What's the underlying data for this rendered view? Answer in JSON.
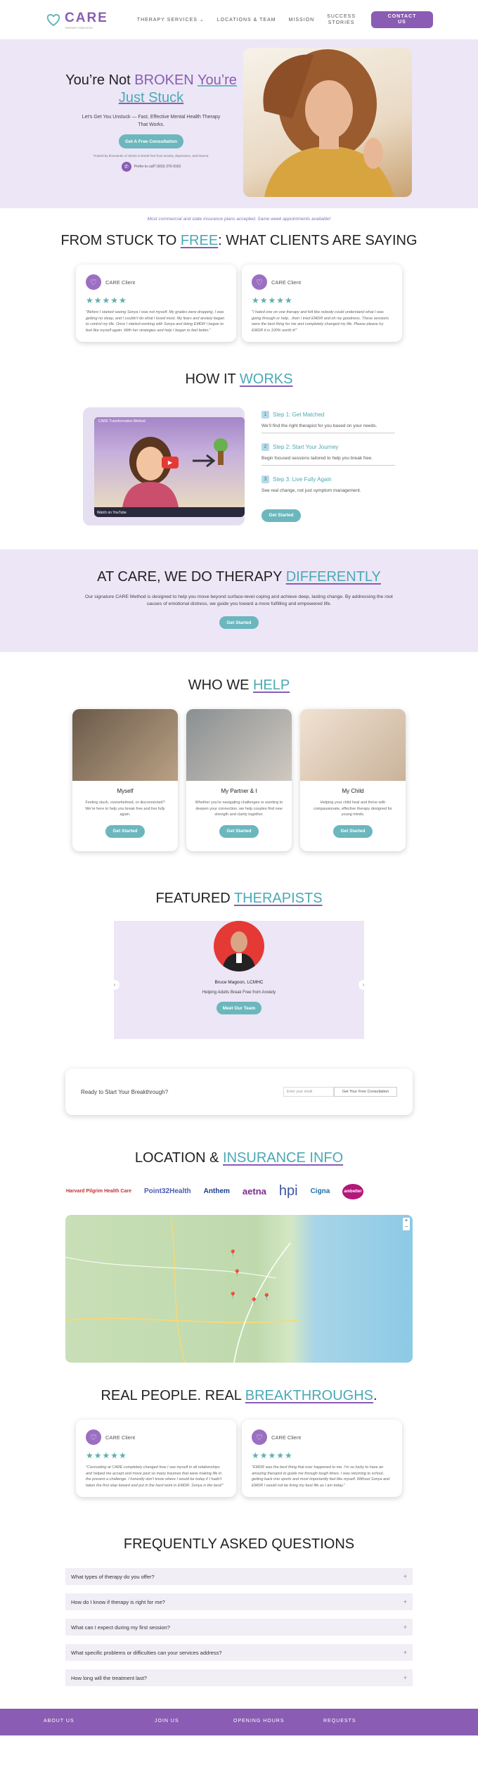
{
  "brand": {
    "name": "CARE",
    "tagline": "THERAPY SERVICES",
    "purple": "#8a5cb3",
    "teal": "#4aa9b5",
    "lavender": "#ece6f6"
  },
  "nav": {
    "items": [
      "THERAPY SERVICES",
      "LOCATIONS & TEAM",
      "MISSION"
    ],
    "success_1": "SUCCESS",
    "success_2": "STORIES",
    "contact_1": "CONTACT",
    "contact_2": "US"
  },
  "hero": {
    "title_1": "You’re Not",
    "title_broken": "BROKEN",
    "title_youre": "You’re",
    "title_stuck": "Just Stuck",
    "subtitle": "Let’s Get You Unstuck — Fast, Effective Mental Health Therapy That Works.",
    "cta": "Get A Free Consultation",
    "trust": "Trusted by thousands of clients to break free from anxiety, depression, and trauma.",
    "call": "Prefer to call? (603) 370-9163"
  },
  "insurance_note": "Most commercial and state insurance plans accepted. Same week appointments available!",
  "testimonials": {
    "title_a": "FROM STUCK TO ",
    "title_hl": "FREE",
    "title_b": ": WHAT CLIENTS ARE SAYING",
    "items": [
      {
        "name": "CARE Client",
        "stars": "★★★★★",
        "text": "\"Before I started seeing Sonya I was not myself. My grades were dropping, I was getting no sleep, and I couldn’t do what I loved most. My fears and anxiety began to control my life. Once I started working with Sonya and doing EMDR I began to feel like myself again. With her strategies and help I began to feel better.\""
      },
      {
        "name": "CARE Client",
        "stars": "★★★★★",
        "text": "\"I hated one on one therapy and felt like nobody could understand what I was going through or help…then I tried EMDR and oh my goodness. These sessions were the best thing for me and completely changed my life. Please please try EMDR it is 100% worth it!\""
      }
    ]
  },
  "how": {
    "title_a": "HOW IT ",
    "title_hl": "WORKS",
    "video_title": "CARE Transformation Method",
    "video_watch": "Watch on YouTube",
    "steps": [
      {
        "n": "1",
        "title": "Step 1: Get Matched",
        "desc": "We’ll find the right therapist for you based on your needs."
      },
      {
        "n": "2",
        "title": "Step 2: Start Your Journey",
        "desc": "Begin focused sessions tailored to help you break free."
      },
      {
        "n": "3",
        "title": "Step 3: Live Fully Again",
        "desc": "See real change, not just symptom management."
      }
    ],
    "cta": "Get Started"
  },
  "diff": {
    "title_a": "AT CARE, WE DO THERAPY ",
    "title_hl": "DIFFERENTLY",
    "text": "Our signature CARE Method is designed to help you move beyond surface-level coping and achieve deep, lasting change. By addressing the root causes of emotional distress, we guide you toward a more fulfilling and empowered life.",
    "cta": "Get Started"
  },
  "who": {
    "title_a": "WHO WE ",
    "title_hl": "HELP",
    "cards": [
      {
        "title": "Myself",
        "text": "Feeling stuck, overwhelmed, or disconnected? We’re here to help you break free and live fully again.",
        "cta": "Get Started"
      },
      {
        "title": "My Partner & I",
        "text": "Whether you’re navigating challenges or wanting to deepen your connection, we help couples find new strength and clarity together.",
        "cta": "Get Started"
      },
      {
        "title": "My Child",
        "text": "Helping your child heal and thrive with compassionate, effective therapy designed for young minds.",
        "cta": "Get Started"
      }
    ]
  },
  "featured": {
    "title_a": "FEATURED ",
    "title_hl": "THERAPISTS",
    "name": "Bruce Magoon, LCMHC",
    "sub": "Helping Adults Break Free from Anxiety",
    "cta": "Meet Our Team"
  },
  "breakthrough": {
    "label": "Ready to Start Your Breakthrough?",
    "placeholder": "Enter your email",
    "button": "Get Your Free Consultation"
  },
  "insurance": {
    "title_a": "LOCATION & ",
    "title_hl": "INSURANCE INFO",
    "logos": [
      "Harvard Pilgrim Health Care",
      "Point32Health",
      "Anthem",
      "aetna",
      "hpi",
      "Cigna",
      "ambetter"
    ]
  },
  "real": {
    "title_a": "REAL PEOPLE. REAL ",
    "title_hl": "BREAKTHROUGHS",
    "title_b": ".",
    "items": [
      {
        "name": "CARE Client",
        "stars": "★★★★★",
        "text": "\"Counseling at CARE completely changed how I see myself in all relationships and helped me accept and move past so many traumas that were making life in the present a challenge. I honestly don't know where I would be today if I hadn't taken the first step toward and put in the hard work in EMDR. Sonya is the best!\""
      },
      {
        "name": "CARE Client",
        "stars": "★★★★★",
        "text": "\"EMDR was the best thing that ever happened to me. I’m so lucky to have an amazing therapist to guide me through tough times. I was returning to school, getting back into sports and most importantly feel like myself. Without Sonya and EMDR I would not be living my best life as I am today.\""
      }
    ]
  },
  "faq": {
    "title": "FREQUENTLY ASKED QUESTIONS",
    "items": [
      "What types of therapy do you offer?",
      "How do I know if therapy is right for me?",
      "What can I expect during my first session?",
      "What specific problems or difficulties can your services address?",
      "How long will the treatment last?"
    ]
  },
  "footer": [
    "ABOUT US",
    "JOIN US",
    "OPENING HOURS",
    "REQUESTS"
  ]
}
